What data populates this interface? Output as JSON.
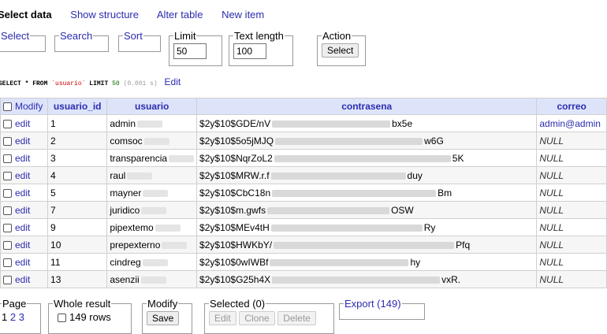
{
  "menu": {
    "select_data": "Select data",
    "show_structure": "Show structure",
    "alter_table": "Alter table",
    "new_item": "New item"
  },
  "filters": {
    "select_legend": "Select",
    "search_legend": "Search",
    "sort_legend": "Sort",
    "limit_legend": "Limit",
    "limit_value": "50",
    "text_length_legend": "Text length",
    "text_length_value": "100",
    "action_legend": "Action",
    "action_button": "Select"
  },
  "sql": {
    "select": "SELECT * FROM",
    "table": "`usuario`",
    "limit": "LIMIT",
    "limit_value": "50",
    "time": "(0.001 s)",
    "edit": "Edit"
  },
  "table": {
    "headers": {
      "modify": "Modify",
      "usuario_id": "usuario_id",
      "usuario": "usuario",
      "contrasena": "contrasena",
      "correo": "correo"
    },
    "edit_label": "edit",
    "rows": [
      {
        "id": "1",
        "user": "admin",
        "hash_start": "$2y$10$GDE/nV",
        "hash_end": "bx5e",
        "correo": "admin@admin"
      },
      {
        "id": "2",
        "user": "comsoc",
        "hash_start": "$2y$10$5o5jMJQ",
        "hash_end": "w6G",
        "correo": "NULL"
      },
      {
        "id": "3",
        "user": "transparencia",
        "hash_start": "$2y$10$NqrZoL2",
        "hash_end": "5K",
        "correo": "NULL"
      },
      {
        "id": "4",
        "user": "raul",
        "hash_start": "$2y$10$MRW.r.f",
        "hash_end": "duy",
        "correo": "NULL"
      },
      {
        "id": "5",
        "user": "mayner",
        "hash_start": "$2y$10$CbC18n",
        "hash_end": "Bm",
        "correo": "NULL"
      },
      {
        "id": "7",
        "user": "juridico",
        "hash_start": "$2y$10$m.gwfs",
        "hash_end": "OSW",
        "correo": "NULL"
      },
      {
        "id": "9",
        "user": "pipextemo",
        "hash_start": "$2y$10$MEv4tH",
        "hash_end": "Ry",
        "correo": "NULL"
      },
      {
        "id": "10",
        "user": "prepexterno",
        "hash_start": "$2y$10$HWKbY/",
        "hash_end": "Pfq",
        "correo": "NULL"
      },
      {
        "id": "11",
        "user": "cindreg",
        "hash_start": "$2y$10$0wIWBf",
        "hash_end": "hy",
        "correo": "NULL"
      },
      {
        "id": "13",
        "user": "asenzii",
        "hash_start": "$2y$10$G25h4X",
        "hash_end": "vxR.",
        "correo": "NULL"
      }
    ]
  },
  "footer": {
    "page_legend": "Page",
    "pages": [
      "1",
      "2",
      "3"
    ],
    "whole_result_legend": "Whole result",
    "rows_count": "149 rows",
    "modify_legend": "Modify",
    "save_button": "Save",
    "selected_legend": "Selected (0)",
    "edit_button": "Edit",
    "clone_button": "Clone",
    "delete_button": "Delete",
    "export_legend": "Export (149)"
  },
  "colors": {
    "link": "#2c2cb0",
    "header_bg": "#dde4fa",
    "sql_string": "#cc0000",
    "sql_number": "#006600"
  }
}
